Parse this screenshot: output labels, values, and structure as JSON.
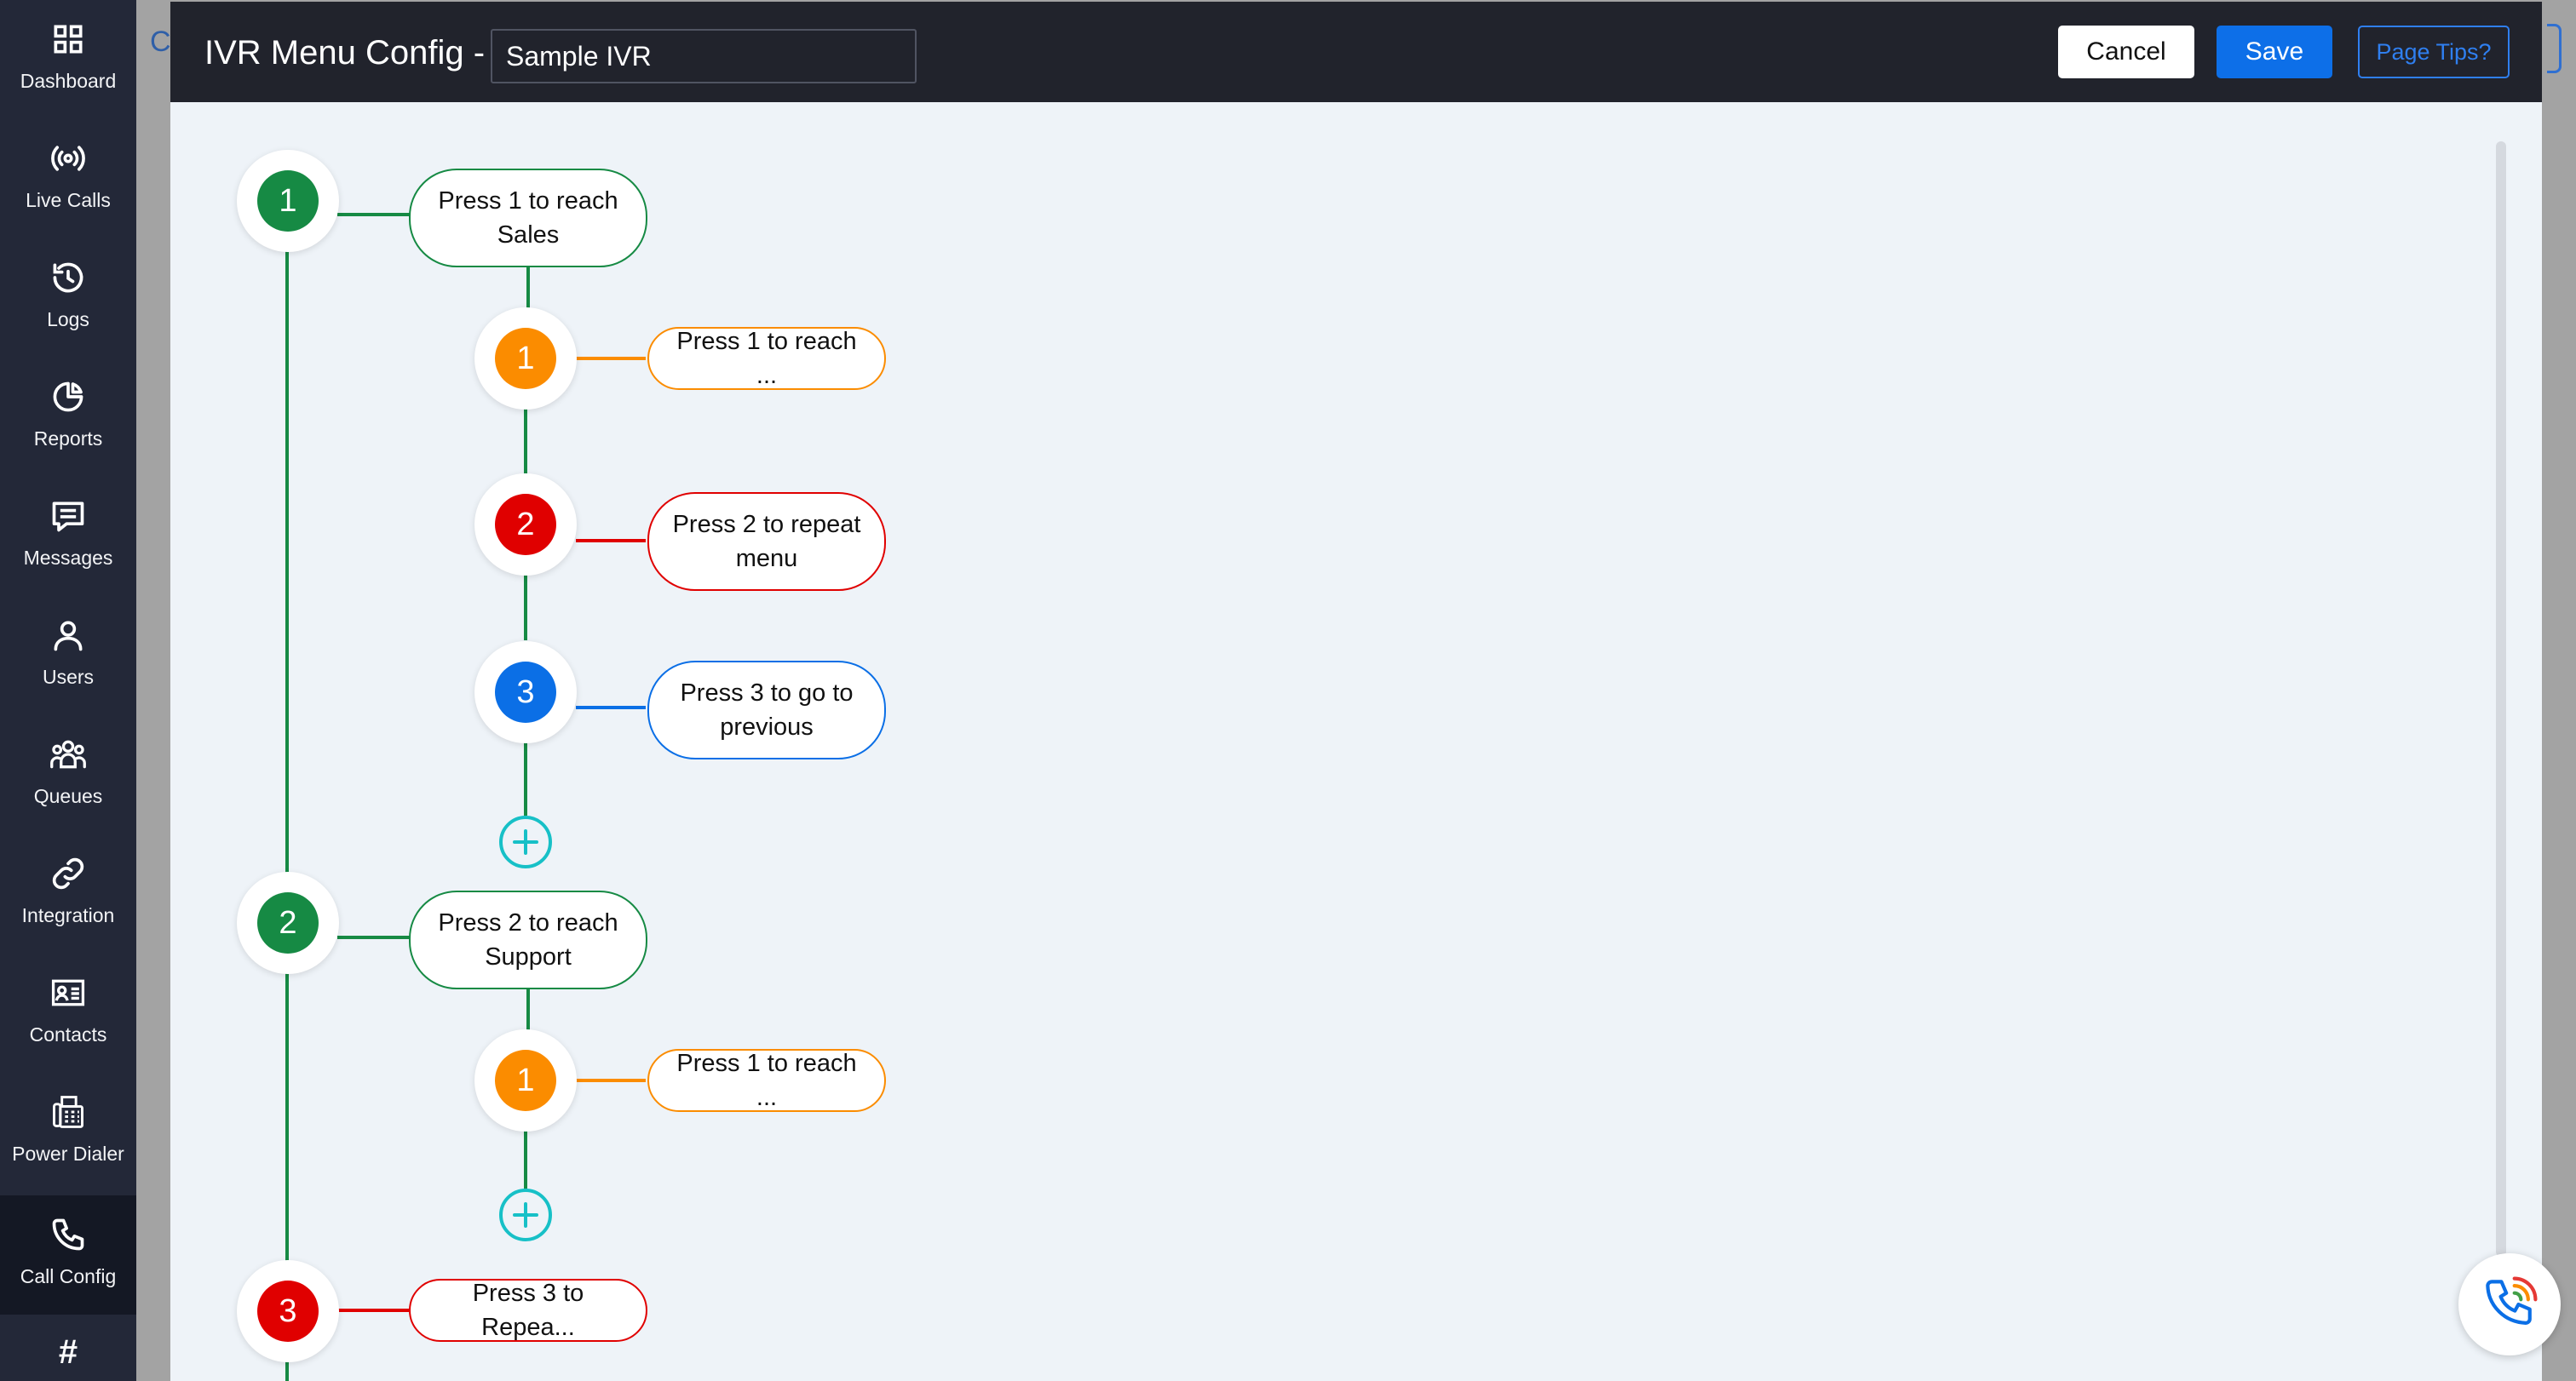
{
  "sidebar": {
    "items": [
      {
        "label": "Dashboard",
        "icon": "grid-icon"
      },
      {
        "label": "Live Calls",
        "icon": "broadcast-icon"
      },
      {
        "label": "Logs",
        "icon": "history-icon"
      },
      {
        "label": "Reports",
        "icon": "pie-chart-icon"
      },
      {
        "label": "Messages",
        "icon": "message-icon"
      },
      {
        "label": "Users",
        "icon": "user-icon"
      },
      {
        "label": "Queues",
        "icon": "group-icon"
      },
      {
        "label": "Integration",
        "icon": "link-icon"
      },
      {
        "label": "Contacts",
        "icon": "contact-card-icon"
      },
      {
        "label": "Power Dialer",
        "icon": "fax-icon"
      },
      {
        "label": "Call Config",
        "icon": "phone-icon",
        "active": true
      }
    ],
    "bottom_glyph": "#"
  },
  "background": {
    "partial_tab_text": "C"
  },
  "modal": {
    "title": "IVR Menu Config -",
    "ivr_name": "Sample IVR",
    "cancel_label": "Cancel",
    "save_label": "Save",
    "tips_label": "Page Tips?"
  },
  "colors": {
    "green": "#168a44",
    "orange": "#fb8c00",
    "red": "#e00000",
    "blue": "#0b6fe6",
    "teal": "#17c0c7",
    "header": "#21232c",
    "sidebar": "#232838"
  },
  "tree": {
    "nodes": [
      {
        "digit": "1",
        "color": "green",
        "label": "Press 1 to reach\nSales",
        "children": [
          {
            "digit": "1",
            "color": "orange",
            "label": "Press 1 to reach ..."
          },
          {
            "digit": "2",
            "color": "red",
            "label": "Press 2 to repeat\nmenu"
          },
          {
            "digit": "3",
            "color": "blue",
            "label": "Press 3 to go to\nprevious"
          }
        ]
      },
      {
        "digit": "2",
        "color": "green",
        "label": "Press 2 to reach\nSupport",
        "children": [
          {
            "digit": "1",
            "color": "orange",
            "label": "Press 1 to reach ..."
          }
        ]
      },
      {
        "digit": "3",
        "color": "red",
        "label": "Press 3 to Repea...",
        "children": []
      }
    ]
  }
}
